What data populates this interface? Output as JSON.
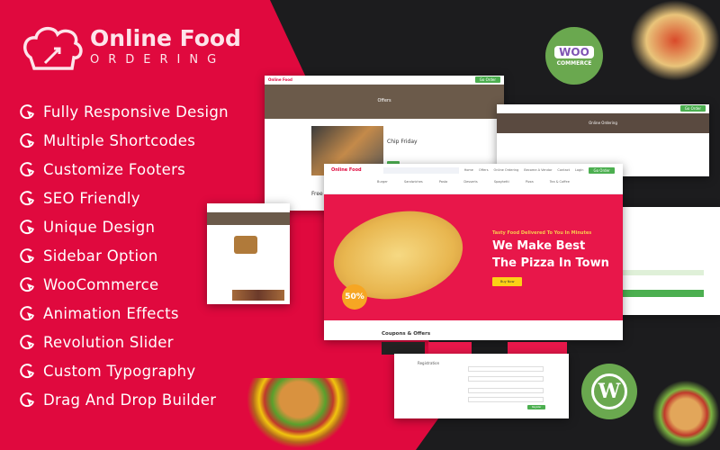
{
  "brand": {
    "name_line1": "Online Food",
    "name_line2": "ORDERING"
  },
  "features": [
    "Fully Responsive Design",
    "Multiple Shortcodes",
    "Customize Footers",
    "SEO Friendly",
    "Unique Design",
    "Sidebar Option",
    "WooCommerce",
    "Animation Effects",
    "Revolution Slider",
    "Custom Typography",
    "Drag And Drop Builder"
  ],
  "badges": {
    "woo": "WOO",
    "woo_sub": "COMMERCE",
    "wordpress": "W"
  },
  "colors": {
    "red": "#e0093e",
    "dark": "#1c1c1e",
    "green": "#4caf50",
    "yellow": "#fcd116"
  },
  "screens": {
    "offers_page": {
      "title": "Offers",
      "product": "Chip Friday",
      "text": "Free S"
    },
    "online_ordering_page": {
      "title": "Online Ordering"
    },
    "home": {
      "nav": [
        "Home",
        "Offers",
        "Online Ordering",
        "Become A Vendor",
        "Contact",
        "Login"
      ],
      "order_button": "Go Order",
      "categories": [
        "Burger",
        "Sandwiches",
        "Pasta",
        "Desserts",
        "Spaghetti",
        "Pizza",
        "Tea & Coffee"
      ],
      "hero_subtitle": "Tasty Food Delivered To You In Minutes",
      "hero_title": "We Make Best The Pizza In Town",
      "hero_button": "Buy Now",
      "discount": "50%",
      "section_title": "Coupons & Offers"
    },
    "registration": {
      "title": "Registration",
      "submit": "Register"
    }
  }
}
